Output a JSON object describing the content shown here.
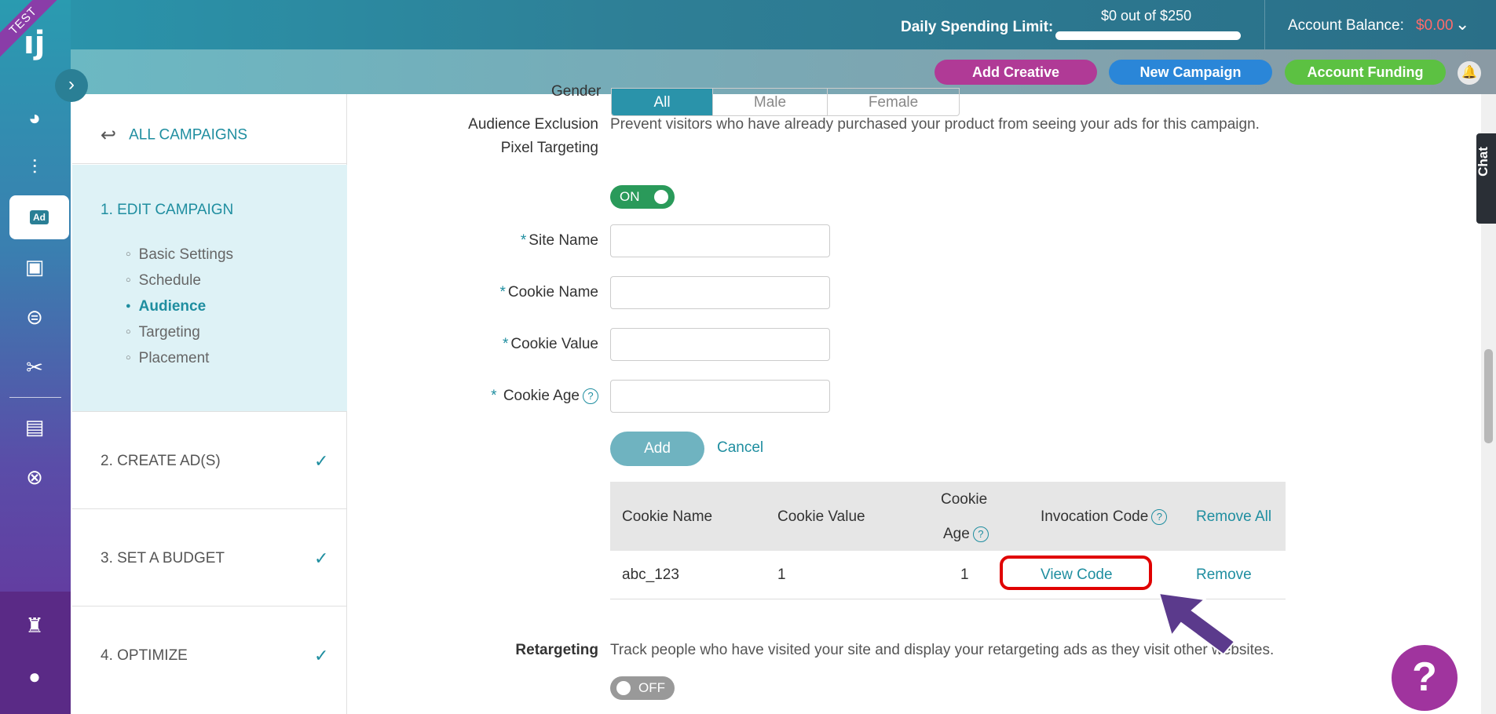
{
  "rail": {
    "ribbon": "TEST",
    "logo": "ıj",
    "icons": [
      "dashboard-icon",
      "analytics-icon",
      "ad-icon",
      "creatives-icon",
      "billing-icon",
      "tools-icon",
      "reports-icon",
      "support-icon",
      "rook-icon",
      "user-icon"
    ],
    "active_icon_label": "Ad"
  },
  "topbar": {
    "spend_label": "Daily Spending Limit:",
    "spend_value": "$0 out of $250",
    "account_label": "Account Balance:",
    "account_value": "$0.00"
  },
  "actions": {
    "add_creative": "Add Creative",
    "new_campaign": "New Campaign",
    "account_funding": "Account Funding"
  },
  "steps": {
    "back": "ALL CAMPAIGNS",
    "step1": "1. EDIT CAMPAIGN",
    "sub": [
      "Basic Settings",
      "Schedule",
      "Audience",
      "Targeting",
      "Placement"
    ],
    "step2": "2. CREATE AD(S)",
    "step3": "3. SET A BUDGET",
    "step4": "4. OPTIMIZE"
  },
  "form": {
    "gender_label": "Gender",
    "gender_options": [
      "All",
      "Male",
      "Female"
    ],
    "exclusion_label_1": "Audience Exclusion",
    "exclusion_label_2": "Pixel Targeting",
    "exclusion_desc": "Prevent visitors who have already purchased your product from seeing your ads for this campaign.",
    "exclusion_toggle": "ON",
    "site_name": "Site Name",
    "cookie_name": "Cookie Name",
    "cookie_value": "Cookie Value",
    "cookie_age": "Cookie Age",
    "add": "Add",
    "cancel": "Cancel",
    "retargeting_label": "Retargeting",
    "retargeting_desc": "Track people who have visited your site and display your retargeting ads as they visit other websites.",
    "retargeting_toggle": "OFF"
  },
  "table": {
    "headers": {
      "cookie_name": "Cookie Name",
      "cookie_value": "Cookie Value",
      "cookie_age_1": "Cookie",
      "cookie_age_2": "Age",
      "invocation": "Invocation Code",
      "remove_all": "Remove All"
    },
    "rows": [
      {
        "name": "abc_123",
        "value": "1",
        "age": "1",
        "view": "View Code",
        "remove": "Remove"
      }
    ]
  },
  "chat": "Chat",
  "help_fab": "?",
  "colors": {
    "accent": "#1f8ea0",
    "highlight": "#e00000",
    "arrow": "#5b3a8c"
  }
}
